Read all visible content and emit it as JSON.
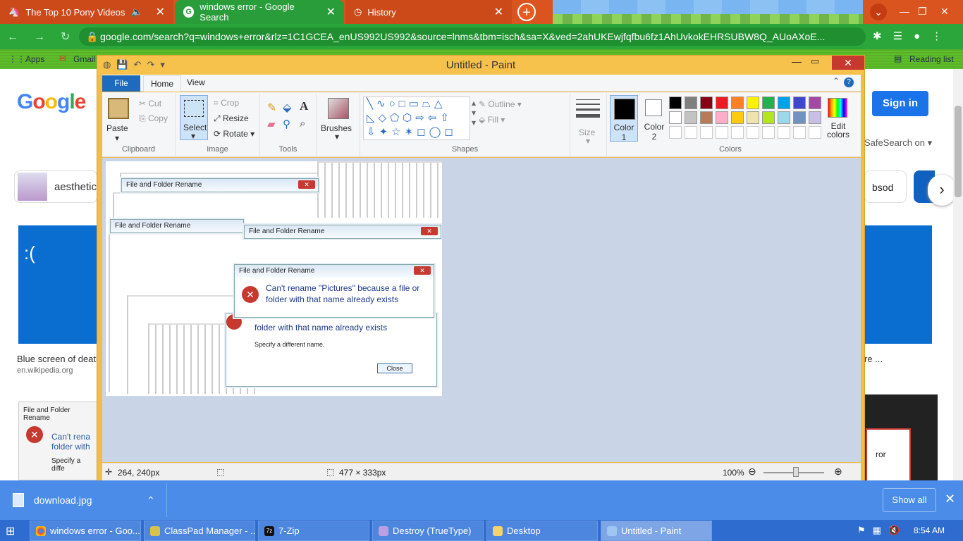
{
  "browser": {
    "tabs": [
      {
        "title": "The Top 10 Pony Videos",
        "favicon": "pony-icon",
        "has_audio": true
      },
      {
        "title": "windows error - Google Search",
        "favicon": "google-icon",
        "active": true
      },
      {
        "title": "History",
        "favicon": "history-icon"
      }
    ],
    "address": "google.com/search?q=windows+error&rlz=1C1GCEA_enUS992US992&source=lnms&tbm=isch&sa=X&ved=2ahUKEwjfqfbu6fz1AhUvkokEHRSUBW8Q_AUoAXoE...",
    "bookmarks": {
      "apps": "Apps",
      "gmail": "Gmail",
      "reading_list": "Reading list"
    }
  },
  "google": {
    "logo": "Google",
    "sign_in": "Sign in",
    "safesearch": "SafeSearch on",
    "chip_left": "aesthetic",
    "chip_right": "bsod",
    "result1_title": "Blue screen of death",
    "result1_source": "en.wikipedia.org",
    "result2_title": "re ...",
    "bsod_face": ":(",
    "thumb_title": "File and Folder Rename",
    "thumb_text1": "Can't rena",
    "thumb_text2": "folder with",
    "thumb_text3": "Specify a diffe",
    "thumb_right_text": "ror"
  },
  "paint": {
    "title": "Untitled - Paint",
    "tabs": {
      "file": "File",
      "home": "Home",
      "view": "View"
    },
    "clipboard": {
      "paste": "Paste",
      "cut": "Cut",
      "copy": "Copy",
      "label": "Clipboard"
    },
    "image": {
      "select": "Select",
      "crop": "Crop",
      "resize": "Resize",
      "rotate": "Rotate",
      "label": "Image"
    },
    "tools": {
      "label": "Tools"
    },
    "brushes": "Brushes",
    "shapes": {
      "label": "Shapes",
      "outline": "Outline",
      "fill": "Fill"
    },
    "size": "Size",
    "color1": "Color 1",
    "color2": "Color 2",
    "colors_label": "Colors",
    "edit_colors": "Edit colors",
    "palette_row1": [
      "#000000",
      "#7f7f7f",
      "#880015",
      "#ed1c24",
      "#ff7f27",
      "#fff200",
      "#22b14c",
      "#00a2e8",
      "#3f48cc",
      "#a349a4"
    ],
    "palette_row2": [
      "#ffffff",
      "#c3c3c3",
      "#b97a57",
      "#ffaec9",
      "#ffc90e",
      "#efe4b0",
      "#b5e61d",
      "#99d9ea",
      "#7092be",
      "#c8bfe7"
    ],
    "status": {
      "cursor": "264, 240px",
      "size": "477 × 333px",
      "zoom": "100%"
    },
    "canvas_dialog": {
      "title": "File and Folder Rename",
      "message1": "Can't rename \"Pictures\" because a file or",
      "message2": "folder with that name already exists",
      "message3": "folder with that name already exists",
      "message4": "Specify a different name.",
      "close": "Close"
    }
  },
  "download": {
    "file": "download.jpg",
    "show_all": "Show all"
  },
  "taskbar": {
    "items": [
      {
        "label": "windows error - Goo...",
        "icon": "chrome-icon"
      },
      {
        "label": "ClassPad Manager - ...",
        "icon": "classpad-icon"
      },
      {
        "label": "7-Zip",
        "icon": "7zip-icon"
      },
      {
        "label": "Destroy (TrueType)",
        "icon": "font-icon"
      },
      {
        "label": "Desktop",
        "icon": "folder-icon"
      },
      {
        "label": "Untitled - Paint",
        "icon": "paint-icon",
        "active": true
      }
    ],
    "clock": "8:54 AM"
  }
}
